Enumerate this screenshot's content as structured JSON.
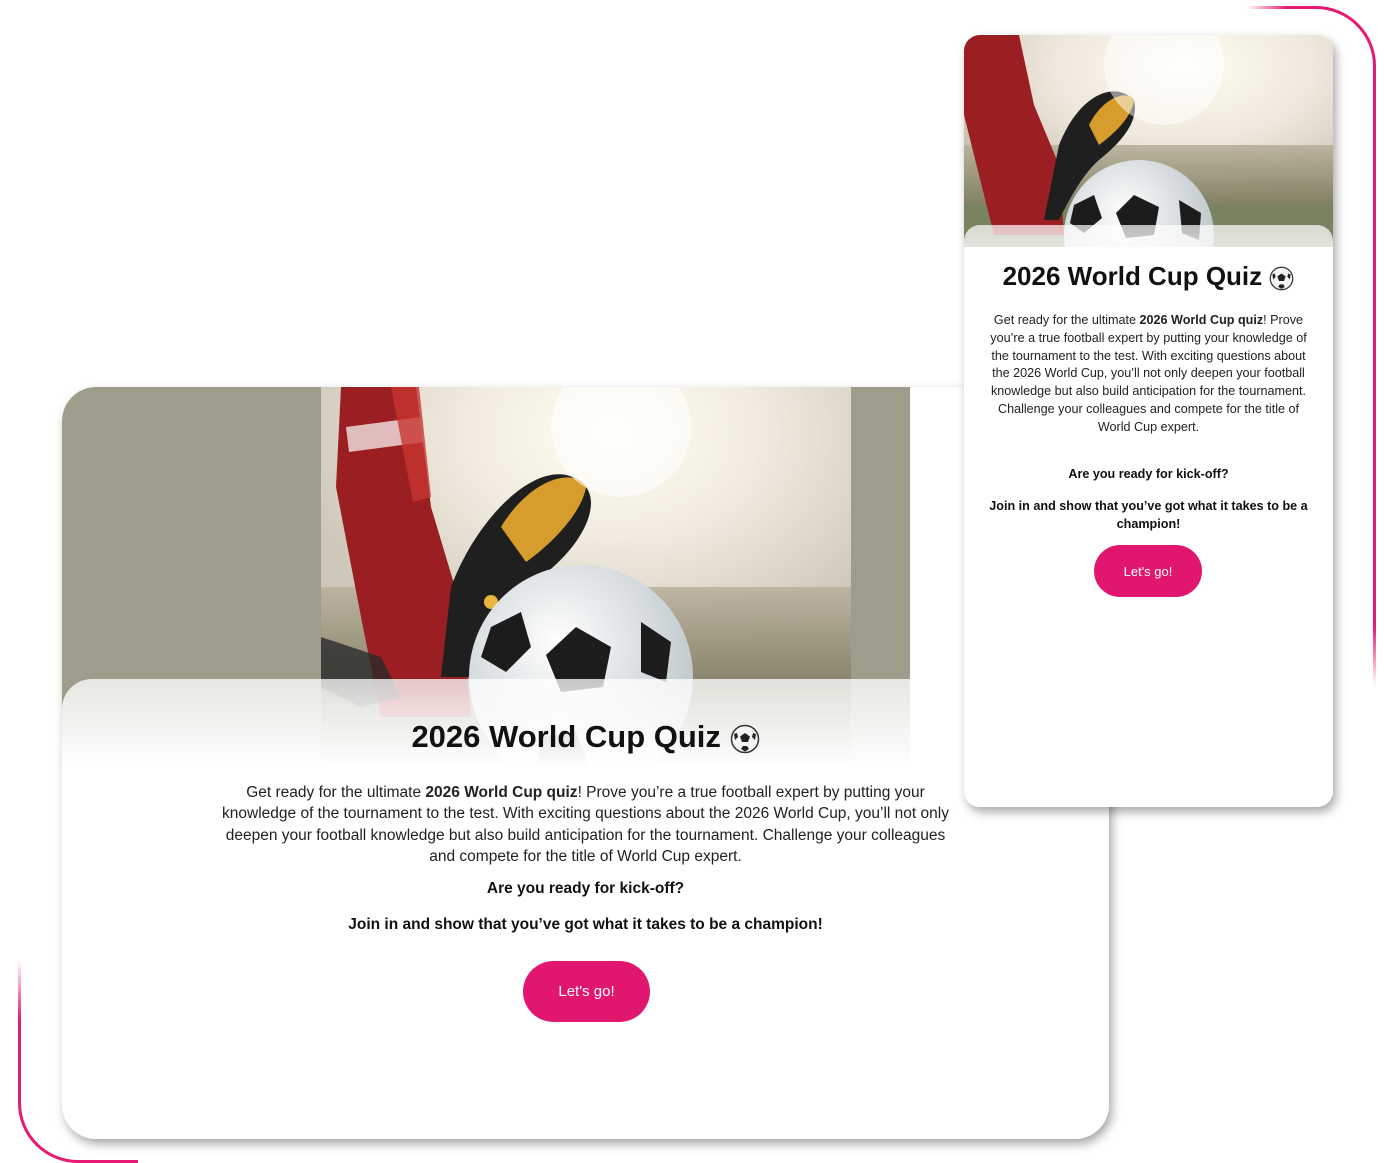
{
  "colors": {
    "accent": "#e1176f",
    "frame": "#e61a73",
    "hero_bg": "#9e9c8a"
  },
  "desktop": {
    "title": "2026 World Cup Quiz",
    "title_icon": "soccer-ball-icon",
    "intro_before": "Get ready for the ultimate ",
    "intro_bold": "2026 World Cup quiz",
    "intro_after": "! Prove you’re a true football expert by putting your knowledge of the tournament to the test. With exciting questions about the 2026 World Cup, you’ll not only deepen your football knowledge but also build anticipation for the tournament. Challenge your colleagues and compete for the title of World Cup expert.",
    "question": "Are you ready for kick-off?",
    "call_to_action": "Join in and show that you’ve got what it takes to be a champion!",
    "button_label": "Let's go!"
  },
  "mobile": {
    "title": "2026 World Cup Quiz",
    "title_icon": "soccer-ball-icon",
    "intro_before": "Get ready for the ultimate ",
    "intro_bold": "2026 World Cup quiz",
    "intro_after": "! Prove you’re a true football expert by putting your knowledge of the tournament to the test. With exciting questions about the 2026 World Cup, you’ll not only deepen your football knowledge but also build anticipation for the tournament. Challenge your colleagues and compete for the title of World Cup expert.",
    "question": "Are you ready for kick-off?",
    "call_to_action": "Join in and show that you’ve got what it takes to be a champion!",
    "button_label": "Let's go!"
  }
}
